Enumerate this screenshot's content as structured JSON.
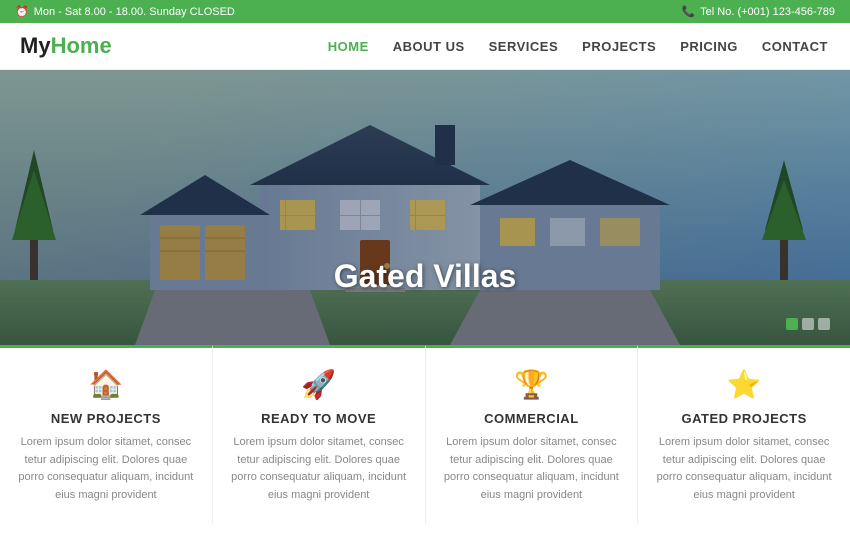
{
  "topbar": {
    "hours": "Mon - Sat 8.00 - 18.00. Sunday CLOSED",
    "phone": "Tel No. (+001) 123-456-789"
  },
  "header": {
    "logo_my": "My",
    "logo_home": "Home",
    "nav": [
      {
        "label": "HOME",
        "active": true
      },
      {
        "label": "ABOUT US",
        "active": false
      },
      {
        "label": "SERVICES",
        "active": false
      },
      {
        "label": "PROJECTS",
        "active": false
      },
      {
        "label": "PRICING",
        "active": false
      },
      {
        "label": "CONTACT",
        "active": false
      }
    ]
  },
  "hero": {
    "title": "Gated Villas"
  },
  "cards": [
    {
      "icon": "🏠",
      "title": "NEW PROJECTS",
      "text": "Lorem ipsum dolor sitamet, consec tetur adipiscing elit. Dolores quae porro consequatur aliquam, incidunt eius magni provident"
    },
    {
      "icon": "🚀",
      "title": "READY TO MOVE",
      "text": "Lorem ipsum dolor sitamet, consec tetur adipiscing elit. Dolores quae porro consequatur aliquam, incidunt eius magni provident"
    },
    {
      "icon": "🏆",
      "title": "COMMERCIAL",
      "text": "Lorem ipsum dolor sitamet, consec tetur adipiscing elit. Dolores quae porro consequatur aliquam, incidunt eius magni provident"
    },
    {
      "icon": "⭐",
      "title": "GATED PROJECTS",
      "text": "Lorem ipsum dolor sitamet, consec tetur adipiscing elit. Dolores quae porro consequatur aliquam, incidunt eius magni provident"
    }
  ],
  "colors": {
    "green": "#4caf50",
    "dark": "#333",
    "light_text": "#888"
  }
}
